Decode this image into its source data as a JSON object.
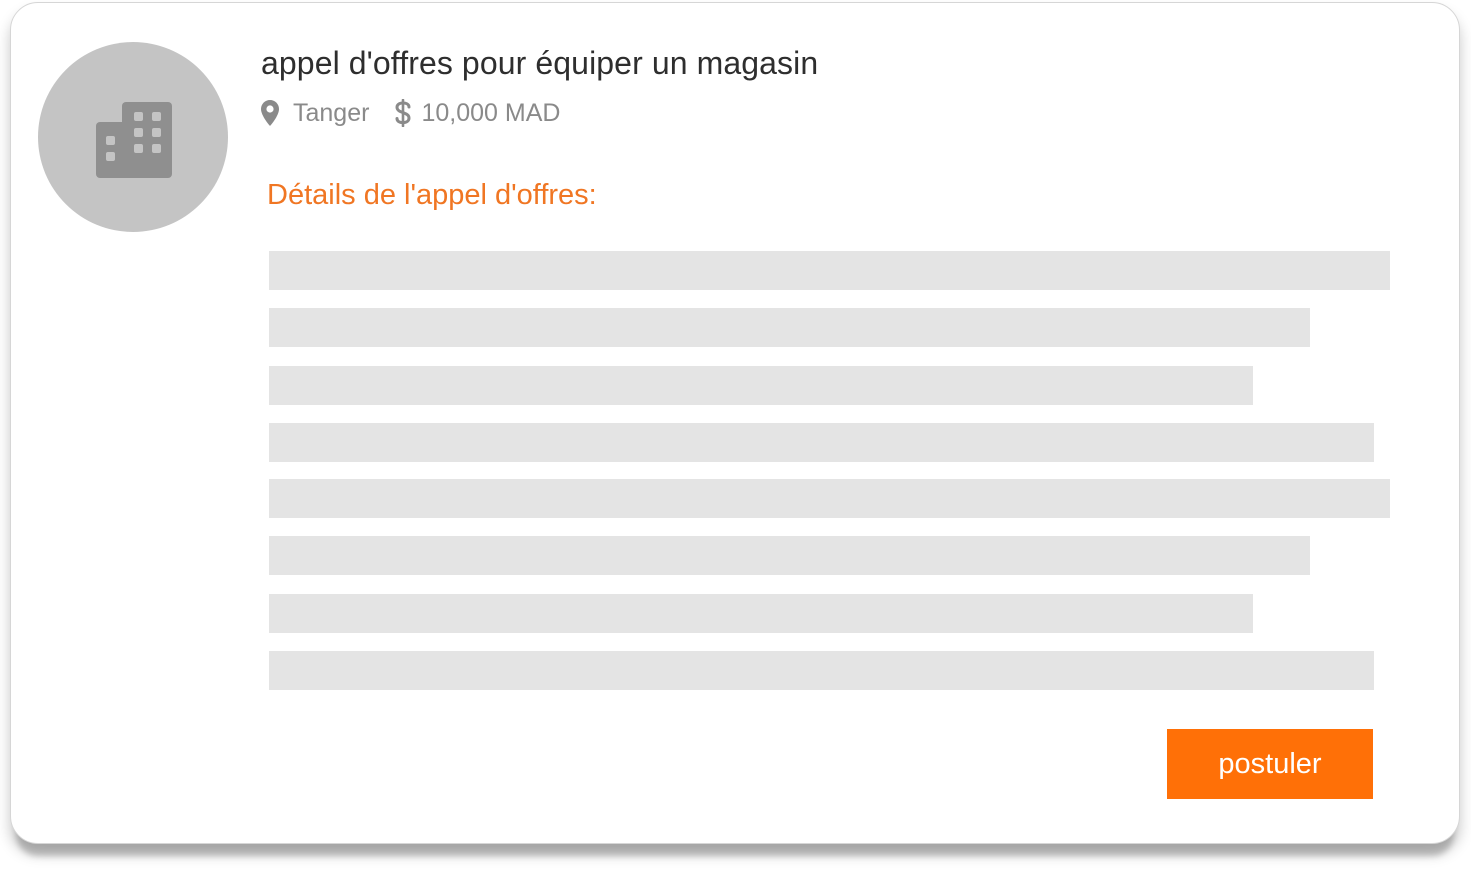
{
  "tender": {
    "title": "appel d'offres pour équiper un magasin",
    "location": "Tanger",
    "budget": "10,000 MAD",
    "details_heading": "Détails de l'appel d'offres:",
    "apply_label": "postuler"
  },
  "icons": {
    "avatar": "building-icon",
    "location": "map-marker-icon",
    "budget": "dollar-icon"
  },
  "colors": {
    "accent": "#f07623",
    "button": "#ff7007",
    "placeholder_line": "#e4e4e4",
    "avatar_bg": "#c4c4c4"
  }
}
